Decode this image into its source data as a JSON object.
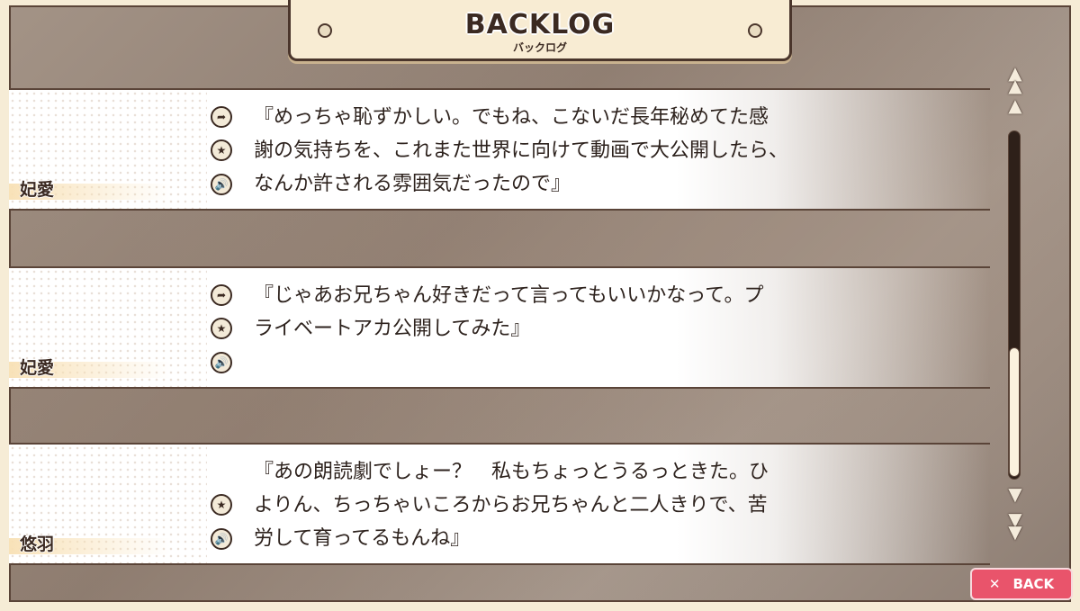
{
  "header": {
    "title": "BACKLOG",
    "subtitle": "バックログ"
  },
  "entries": [
    {
      "speaker": "妃愛",
      "lines": [
        "『めっちゃ恥ずかしい。でもね、こないだ長年秘めてた感",
        "謝の気持ちを、これまた世界に向けて動画で大公開したら、",
        "なんか許される雰囲気だったので』"
      ]
    },
    {
      "speaker": "妃愛",
      "lines": [
        "『じゃあお兄ちゃん好きだって言ってもいいかなって。プ",
        "ライベートアカ公開してみた』"
      ]
    },
    {
      "speaker": "悠羽",
      "lines": [
        "『あの朗読劇でしょー？　私もちょっとうるっときた。ひ",
        "よりん、ちっちゃいころからお兄ちゃんと二人きりで、苦",
        "労して育ってるもんね』"
      ]
    }
  ],
  "icons": {
    "jump": "arrow-jump-icon",
    "favorite": "star-icon",
    "voice": "speaker-icon"
  },
  "scroll": {
    "position": 0.92
  },
  "back_button": {
    "label": "BACK",
    "icon": "close-icon",
    "color": "#e9546b"
  }
}
